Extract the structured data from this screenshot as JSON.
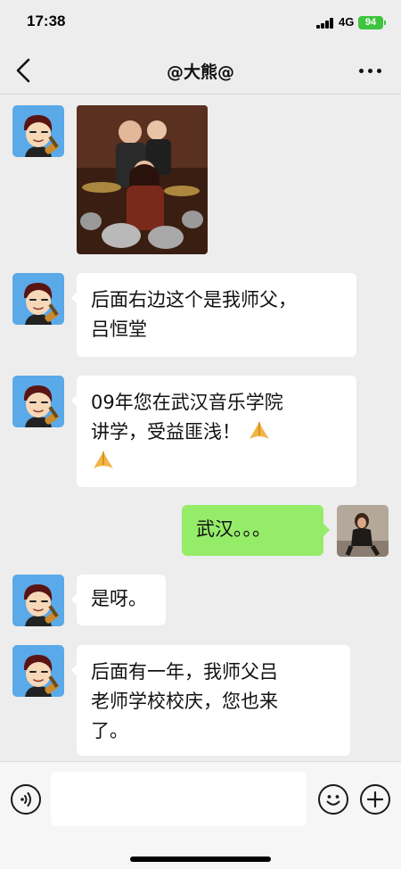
{
  "status_bar": {
    "time": "17:38",
    "network": "4G",
    "battery": "94"
  },
  "header": {
    "title": "@大熊@"
  },
  "messages": [
    {
      "sender": "other",
      "type": "image"
    },
    {
      "sender": "other",
      "type": "text",
      "lines": [
        "后面右边这个是我师父，",
        "吕恒堂"
      ]
    },
    {
      "sender": "other",
      "type": "text",
      "lines": [
        "09年您在武汉音乐学院",
        "讲学，受益匪浅！"
      ],
      "emoji": [
        "folded-hands",
        "folded-hands"
      ]
    },
    {
      "sender": "self",
      "type": "text",
      "lines": [
        "武汉。。。"
      ]
    },
    {
      "sender": "other",
      "type": "text",
      "lines": [
        "是呀。"
      ]
    },
    {
      "sender": "other",
      "type": "text",
      "lines": [
        "后面有一年，我师父吕",
        "老师学校校庆，您也来",
        "了。"
      ]
    }
  ],
  "input": {
    "placeholder": ""
  },
  "icons": {
    "back": "chevron-left-icon",
    "more": "more-dots-icon",
    "voice": "voice-icon",
    "emoji": "emoji-icon",
    "add": "plus-icon"
  },
  "colors": {
    "background": "#ededed",
    "self_bubble": "#95ec69",
    "other_bubble": "#ffffff",
    "battery": "#3ec43e"
  }
}
